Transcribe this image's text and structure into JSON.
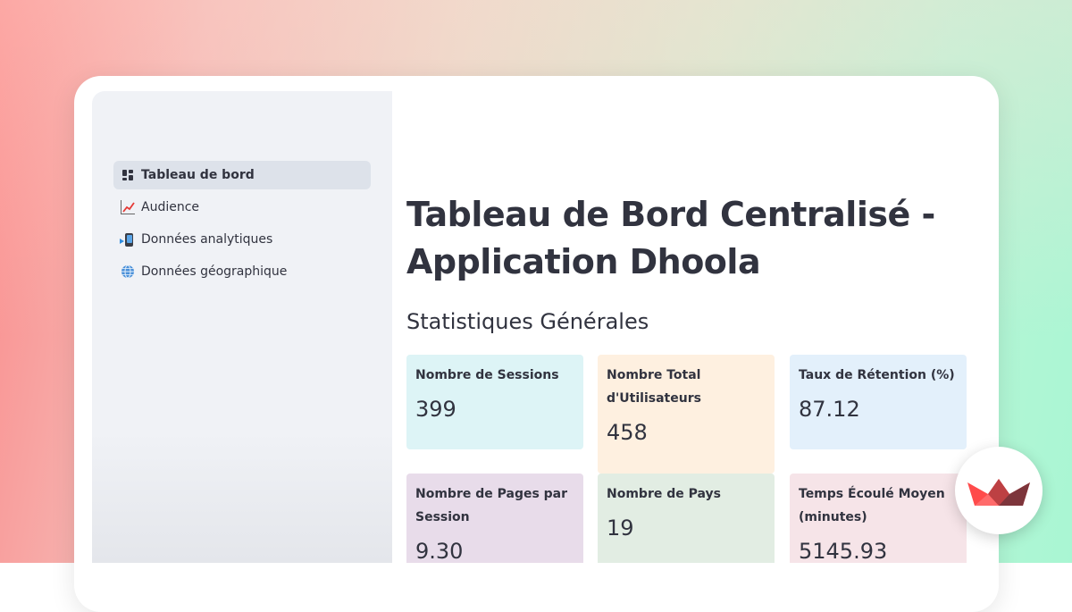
{
  "sidebar": {
    "items": [
      {
        "icon": "dashboard-icon",
        "label": "Tableau de bord",
        "active": true
      },
      {
        "icon": "chart-increasing-icon",
        "label": "Audience",
        "active": false
      },
      {
        "icon": "mobile-arrow-icon",
        "label": "Données analytiques",
        "active": false
      },
      {
        "icon": "globe-icon",
        "label": "Données géographique",
        "active": false
      }
    ]
  },
  "main": {
    "title": "Tableau de Bord Centralisé - Application Dhoola",
    "section_title": "Statistiques Générales",
    "metrics": [
      {
        "label": "Nombre de Sessions",
        "value": "399",
        "color": "#ddf4f6"
      },
      {
        "label": "Nombre Total d'Utilisateurs",
        "value": "458",
        "color": "#fef0e0"
      },
      {
        "label": "Taux de Rétention (%)",
        "value": "87.12",
        "color": "#e3f0fb"
      },
      {
        "label": "Nombre de Pages par Session",
        "value": "9.30",
        "color": "#e8dcea"
      },
      {
        "label": "Nombre de Pays",
        "value": "19",
        "color": "#e2ede3"
      },
      {
        "label": "Temps Écoulé Moyen (minutes)",
        "value": "5145.93",
        "color": "#f6e4e8"
      }
    ]
  },
  "branding": {
    "logo": "streamlit-crown-icon",
    "accent": "#ff4b4b"
  }
}
